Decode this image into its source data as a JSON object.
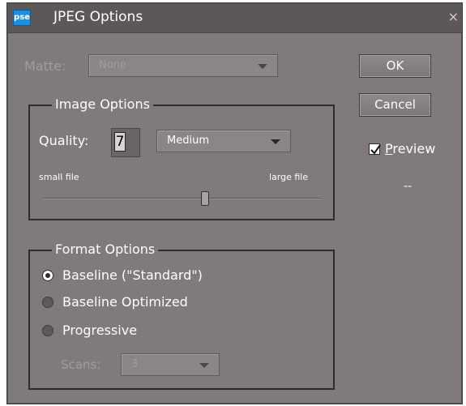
{
  "window": {
    "title": "JPEG Options",
    "app_icon_text": "pse",
    "close_glyph": "×"
  },
  "matte": {
    "label": "Matte:",
    "value": "None"
  },
  "buttons": {
    "ok": "OK",
    "cancel": "Cancel"
  },
  "preview": {
    "label": "Preview",
    "checked": true,
    "file_size": "--"
  },
  "image_options": {
    "legend": "Image Options",
    "quality_label": "Quality:",
    "quality_value": "7",
    "quality_preset": "Medium",
    "small_file_label": "small file",
    "large_file_label": "large file",
    "slider_value": 7,
    "slider_min": 0,
    "slider_max": 12
  },
  "format_options": {
    "legend": "Format Options",
    "options": [
      {
        "label": "Baseline (\"Standard\")",
        "selected": true
      },
      {
        "label": "Baseline Optimized",
        "selected": false
      },
      {
        "label": "Progressive",
        "selected": false
      }
    ],
    "scans_label": "Scans:",
    "scans_value": "3"
  }
}
